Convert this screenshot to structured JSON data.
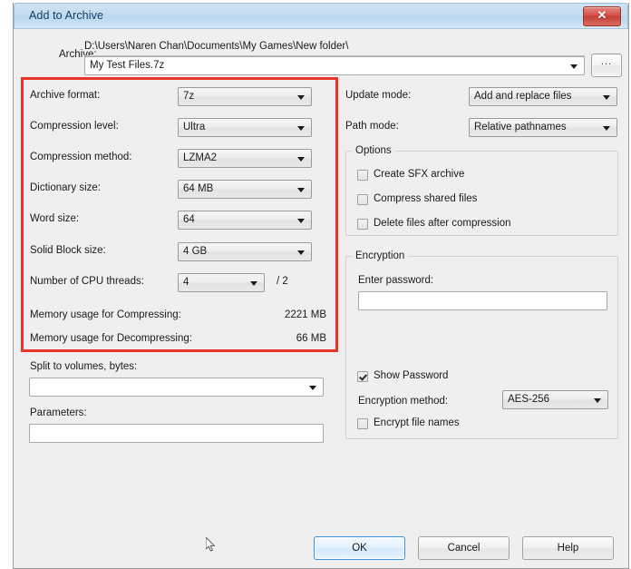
{
  "window": {
    "title": "Add to Archive",
    "close_icon": "close-icon"
  },
  "archive": {
    "label": "Archive:",
    "path": "D:\\Users\\Naren Chan\\Documents\\My Games\\New folder\\",
    "filename": "My Test Files.7z",
    "browse_label": "...",
    "dropdown_icon": "chevron-down-icon"
  },
  "left_panel": {
    "rows": [
      {
        "label": "Archive format:",
        "value": "7z"
      },
      {
        "label": "Compression level:",
        "value": "Ultra"
      },
      {
        "label": "Compression method:",
        "value": "LZMA2"
      },
      {
        "label": "Dictionary size:",
        "value": "64 MB"
      },
      {
        "label": "Word size:",
        "value": "64"
      },
      {
        "label": "Solid Block size:",
        "value": "4 GB"
      }
    ],
    "cpu_threads": {
      "label": "Number of CPU threads:",
      "value": "4",
      "total": "/ 2"
    },
    "memory": [
      {
        "label": "Memory usage for Compressing:",
        "value": "2221 MB"
      },
      {
        "label": "Memory usage for Decompressing:",
        "value": "66 MB"
      }
    ],
    "split": {
      "label": "Split to volumes, bytes:",
      "value": ""
    },
    "parameters": {
      "label": "Parameters:",
      "value": ""
    }
  },
  "right_panel": {
    "update_mode": {
      "label": "Update mode:",
      "value": "Add and replace files"
    },
    "path_mode": {
      "label": "Path mode:",
      "value": "Relative pathnames"
    },
    "options": {
      "title": "Options",
      "items": [
        {
          "label": "Create SFX archive",
          "checked": false
        },
        {
          "label": "Compress shared files",
          "checked": false
        },
        {
          "label": "Delete files after compression",
          "checked": false
        }
      ]
    },
    "encryption": {
      "title": "Encryption",
      "password_label": "Enter password:",
      "password_value": "",
      "show_password": {
        "label": "Show Password",
        "checked": true
      },
      "method": {
        "label": "Encryption method:",
        "value": "AES-256"
      },
      "encrypt_names": {
        "label": "Encrypt file names",
        "checked": false
      }
    }
  },
  "buttons": {
    "ok": "OK",
    "cancel": "Cancel",
    "help": "Help"
  },
  "annotation": {
    "highlight_color": "#e8342a"
  }
}
